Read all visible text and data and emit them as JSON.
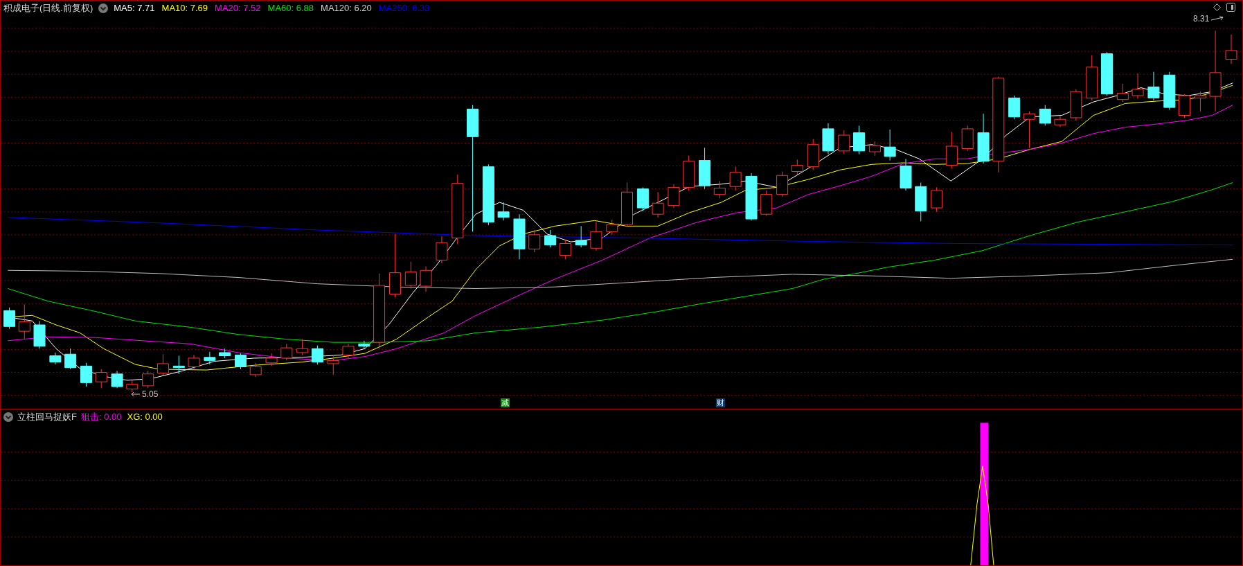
{
  "main_panel": {
    "title": "积成电子(日线.前复权)",
    "legend": [
      {
        "text": "MA5: 7.71",
        "color": "#ffffff"
      },
      {
        "text": "MA10: 7.69",
        "color": "#ffff00"
      },
      {
        "text": "MA20: 7.52",
        "color": "#ff00ff"
      },
      {
        "text": "MA60: 6.88",
        "color": "#00e600"
      },
      {
        "text": "MA120: 6.20",
        "color": "#d0d0d0"
      },
      {
        "text": "MA250: 6.33",
        "color": "#0000ff"
      }
    ],
    "high_label": "8.31",
    "low_label": "5.05",
    "markers": [
      {
        "text": "减",
        "color": "#0a8a0a"
      },
      {
        "text": "财",
        "color": "#0a3a6a"
      }
    ]
  },
  "indicator_panel": {
    "title": "立柱回马捉妖F",
    "values": [
      {
        "text": "狙击: 0.00",
        "color": "#ff00ff"
      },
      {
        "text": "XG: 0.00",
        "color": "#ffff00"
      }
    ]
  }
}
